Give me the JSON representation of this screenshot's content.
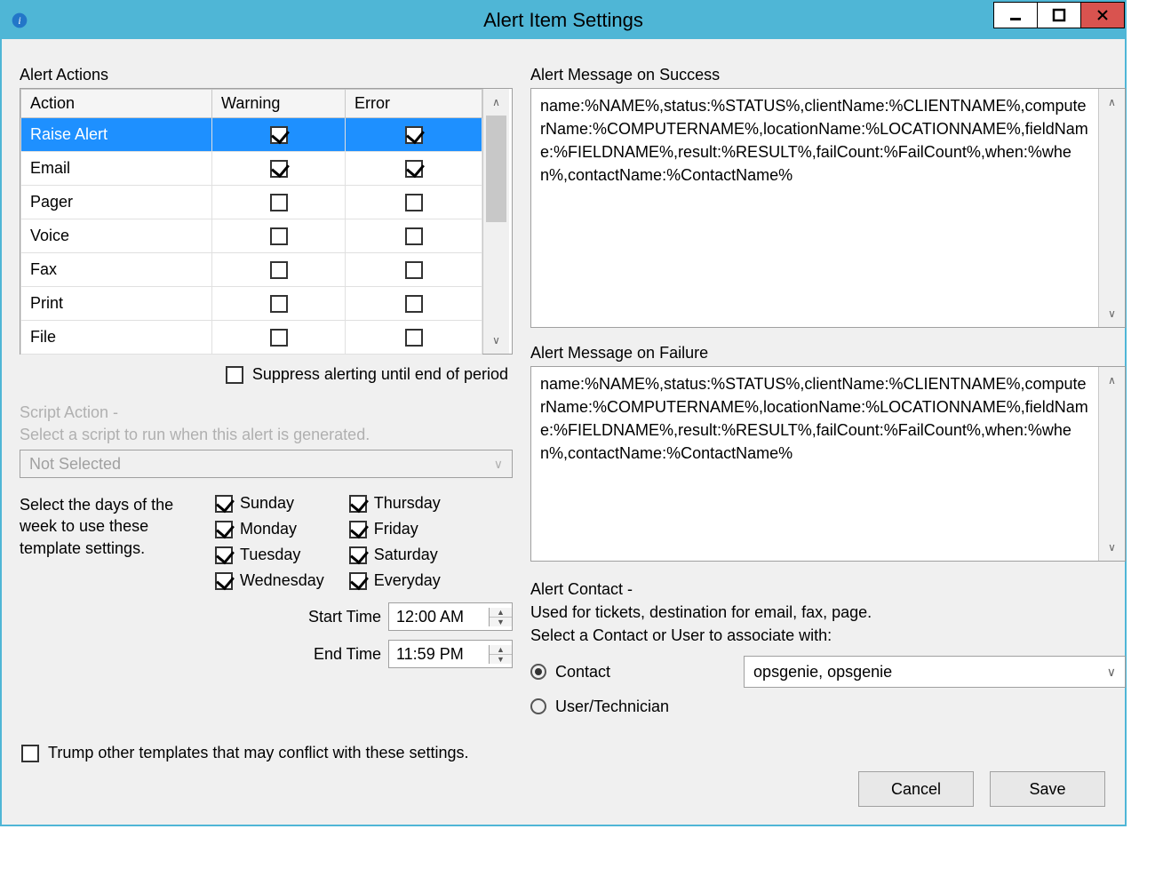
{
  "window": {
    "title": "Alert Item Settings",
    "minimize": "–",
    "maximize": "☐",
    "close": "✕"
  },
  "alertActions": {
    "label": "Alert Actions",
    "headers": {
      "action": "Action",
      "warning": "Warning",
      "error": "Error"
    },
    "rows": [
      {
        "label": "Raise Alert",
        "warning": true,
        "error": true,
        "selected": true
      },
      {
        "label": "Email",
        "warning": true,
        "error": true,
        "selected": false
      },
      {
        "label": "Pager",
        "warning": false,
        "error": false,
        "selected": false
      },
      {
        "label": "Voice",
        "warning": false,
        "error": false,
        "selected": false
      },
      {
        "label": "Fax",
        "warning": false,
        "error": false,
        "selected": false
      },
      {
        "label": "Print",
        "warning": false,
        "error": false,
        "selected": false
      },
      {
        "label": "File",
        "warning": false,
        "error": false,
        "selected": false
      }
    ]
  },
  "suppress": {
    "label": "Suppress alerting until end of period",
    "checked": false
  },
  "scriptAction": {
    "heading": "Script Action -",
    "help": "Select a script to run when this alert is generated.",
    "value": "Not Selected"
  },
  "days": {
    "help": "Select the days of the week to use these template settings.",
    "col1": [
      {
        "label": "Sunday",
        "checked": true
      },
      {
        "label": "Monday",
        "checked": true
      },
      {
        "label": "Tuesday",
        "checked": true
      },
      {
        "label": "Wednesday",
        "checked": true
      }
    ],
    "col2": [
      {
        "label": "Thursday",
        "checked": true
      },
      {
        "label": "Friday",
        "checked": true
      },
      {
        "label": "Saturday",
        "checked": true
      },
      {
        "label": "Everyday",
        "checked": true
      }
    ]
  },
  "startTime": {
    "label": "Start Time",
    "value": "12:00 AM"
  },
  "endTime": {
    "label": "End Time",
    "value": "11:59 PM"
  },
  "trump": {
    "label": "Trump other templates that may conflict with these settings.",
    "checked": false
  },
  "successMsg": {
    "label": "Alert Message on Success",
    "text": "name:%NAME%,status:%STATUS%,clientName:%CLIENTNAME%,computerName:%COMPUTERNAME%,locationName:%LOCATIONNAME%,fieldName:%FIELDNAME%,result:%RESULT%,failCount:%FailCount%,when:%when%,contactName:%ContactName%"
  },
  "failureMsg": {
    "label": "Alert Message on Failure",
    "text": "name:%NAME%,status:%STATUS%,clientName:%CLIENTNAME%,computerName:%COMPUTERNAME%,locationName:%LOCATIONNAME%,fieldName:%FIELDNAME%,result:%RESULT%,failCount:%FailCount%,when:%when%,contactName:%ContactName%"
  },
  "alertContact": {
    "heading": "Alert Contact -",
    "line1": "Used for tickets, destination for email, fax, page.",
    "line2": "Select a Contact or User to associate with:",
    "radios": {
      "contact": {
        "label": "Contact",
        "checked": true
      },
      "user": {
        "label": "User/Technician",
        "checked": false
      }
    },
    "comboValue": "opsgenie, opsgenie"
  },
  "buttons": {
    "cancel": "Cancel",
    "save": "Save"
  }
}
